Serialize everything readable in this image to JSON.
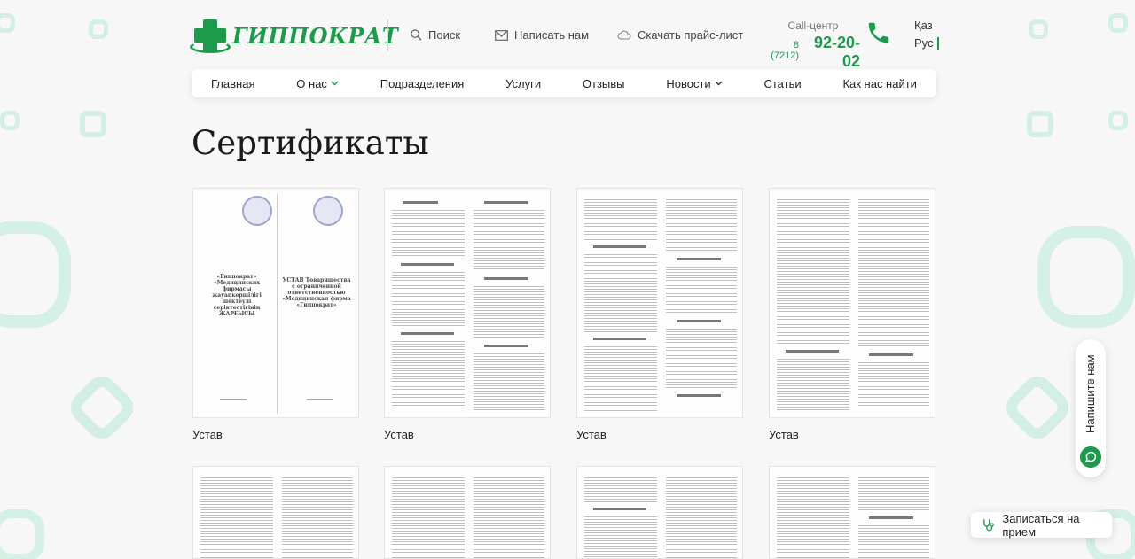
{
  "brand": {
    "logo_text": "ГИППОКРАТ",
    "accent": "#1e9a4c"
  },
  "header": {
    "search_label": "Поиск",
    "write_label": "Написать нам",
    "price_label": "Скачать прайс-лист",
    "call_label": "Call-центр",
    "phone_code": "8 (7212)",
    "phone_number": "92-20-02",
    "lang_kz": "Қаз",
    "lang_ru": "Рус"
  },
  "nav": {
    "items": [
      {
        "label": "Главная"
      },
      {
        "label": "О нас"
      },
      {
        "label": "Подразделения"
      },
      {
        "label": "Услуги"
      },
      {
        "label": "Отзывы"
      },
      {
        "label": "Новости"
      },
      {
        "label": "Статьи"
      },
      {
        "label": "Как нас найти"
      }
    ]
  },
  "page": {
    "title": "Сертификаты"
  },
  "documents": [
    {
      "caption": "Устав"
    },
    {
      "caption": "Устав"
    },
    {
      "caption": "Устав"
    },
    {
      "caption": "Устав"
    }
  ],
  "cover": {
    "heading_left": "«Гиппократ» «Медицинских фирмасы жауапкершілігі шектеулі серіктестігінің ЖАРҒЫСЫ",
    "heading_right": "УСТАВ Товарищества с ограниченной ответственностью «Медицинская фирма «Гиппократ»"
  },
  "floating": {
    "write_us": "Напишите нам",
    "book": "Записаться на прием"
  }
}
